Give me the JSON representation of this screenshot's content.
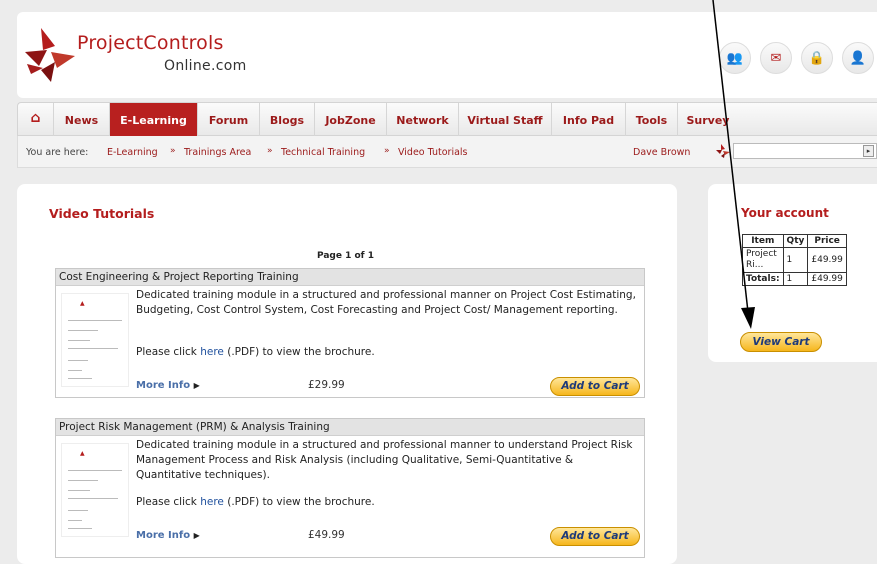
{
  "logo": {
    "line1": "ProjectControls",
    "line2": "Online.com"
  },
  "header_icons": [
    {
      "name": "community-icon",
      "glyph": "👥"
    },
    {
      "name": "mail-icon",
      "glyph": "✉"
    },
    {
      "name": "lock-icon",
      "glyph": "🔒"
    },
    {
      "name": "user-icon",
      "glyph": "👤"
    }
  ],
  "nav": {
    "home_glyph": "⌂",
    "items": [
      "News",
      "E-Learning",
      "Forum",
      "Blogs",
      "JobZone",
      "Network",
      "Virtual Staff",
      "Info Pad",
      "Tools",
      "Survey"
    ],
    "active": "E-Learning"
  },
  "breadcrumb": {
    "prefix": "You are here:",
    "items": [
      "E-Learning",
      "Trainings Area",
      "Technical Training",
      "Video Tutorials"
    ],
    "sep": "»"
  },
  "user_name": "Dave Brown",
  "lang_button": "▸",
  "main": {
    "title": "Video Tutorials",
    "page_info": "Page 1 of 1",
    "courses": [
      {
        "title": "Cost Engineering & Project Reporting Training",
        "desc": "Dedicated training module in a structured and professional manner on Project Cost Estimating, Budgeting, Cost Control System, Cost Forecasting and Project Cost/ Management reporting.",
        "brochure_pre": "Please click ",
        "brochure_link": "here",
        "brochure_post": " (.PDF) to view the brochure.",
        "more_info": "More Info",
        "price": "£29.99",
        "cart_label": "Add to Cart"
      },
      {
        "title": "Project Risk Management (PRM) & Analysis Training",
        "desc": "Dedicated training module in a structured and professional manner to understand Project Risk Management Process and Risk Analysis (including Qualitative, Semi-Quantitative & Quantitative techniques).",
        "brochure_pre": "Please click ",
        "brochure_link": "here",
        "brochure_post": " (.PDF) to view the brochure.",
        "more_info": "More Info",
        "price": "£49.99",
        "cart_label": "Add to Cart"
      }
    ]
  },
  "account": {
    "title": "Your account",
    "headers": [
      "Item",
      "Qty",
      "Price"
    ],
    "row": {
      "item": "Project Ri...",
      "qty": "1",
      "price": "£49.99"
    },
    "totals": {
      "label": "Totals:",
      "qty": "1",
      "price": "£49.99"
    },
    "view_cart": "View Cart"
  },
  "colors": {
    "brand_red": "#b41d1d",
    "button_gold": "#f6b61c",
    "link_blue": "#1e4f9c"
  }
}
